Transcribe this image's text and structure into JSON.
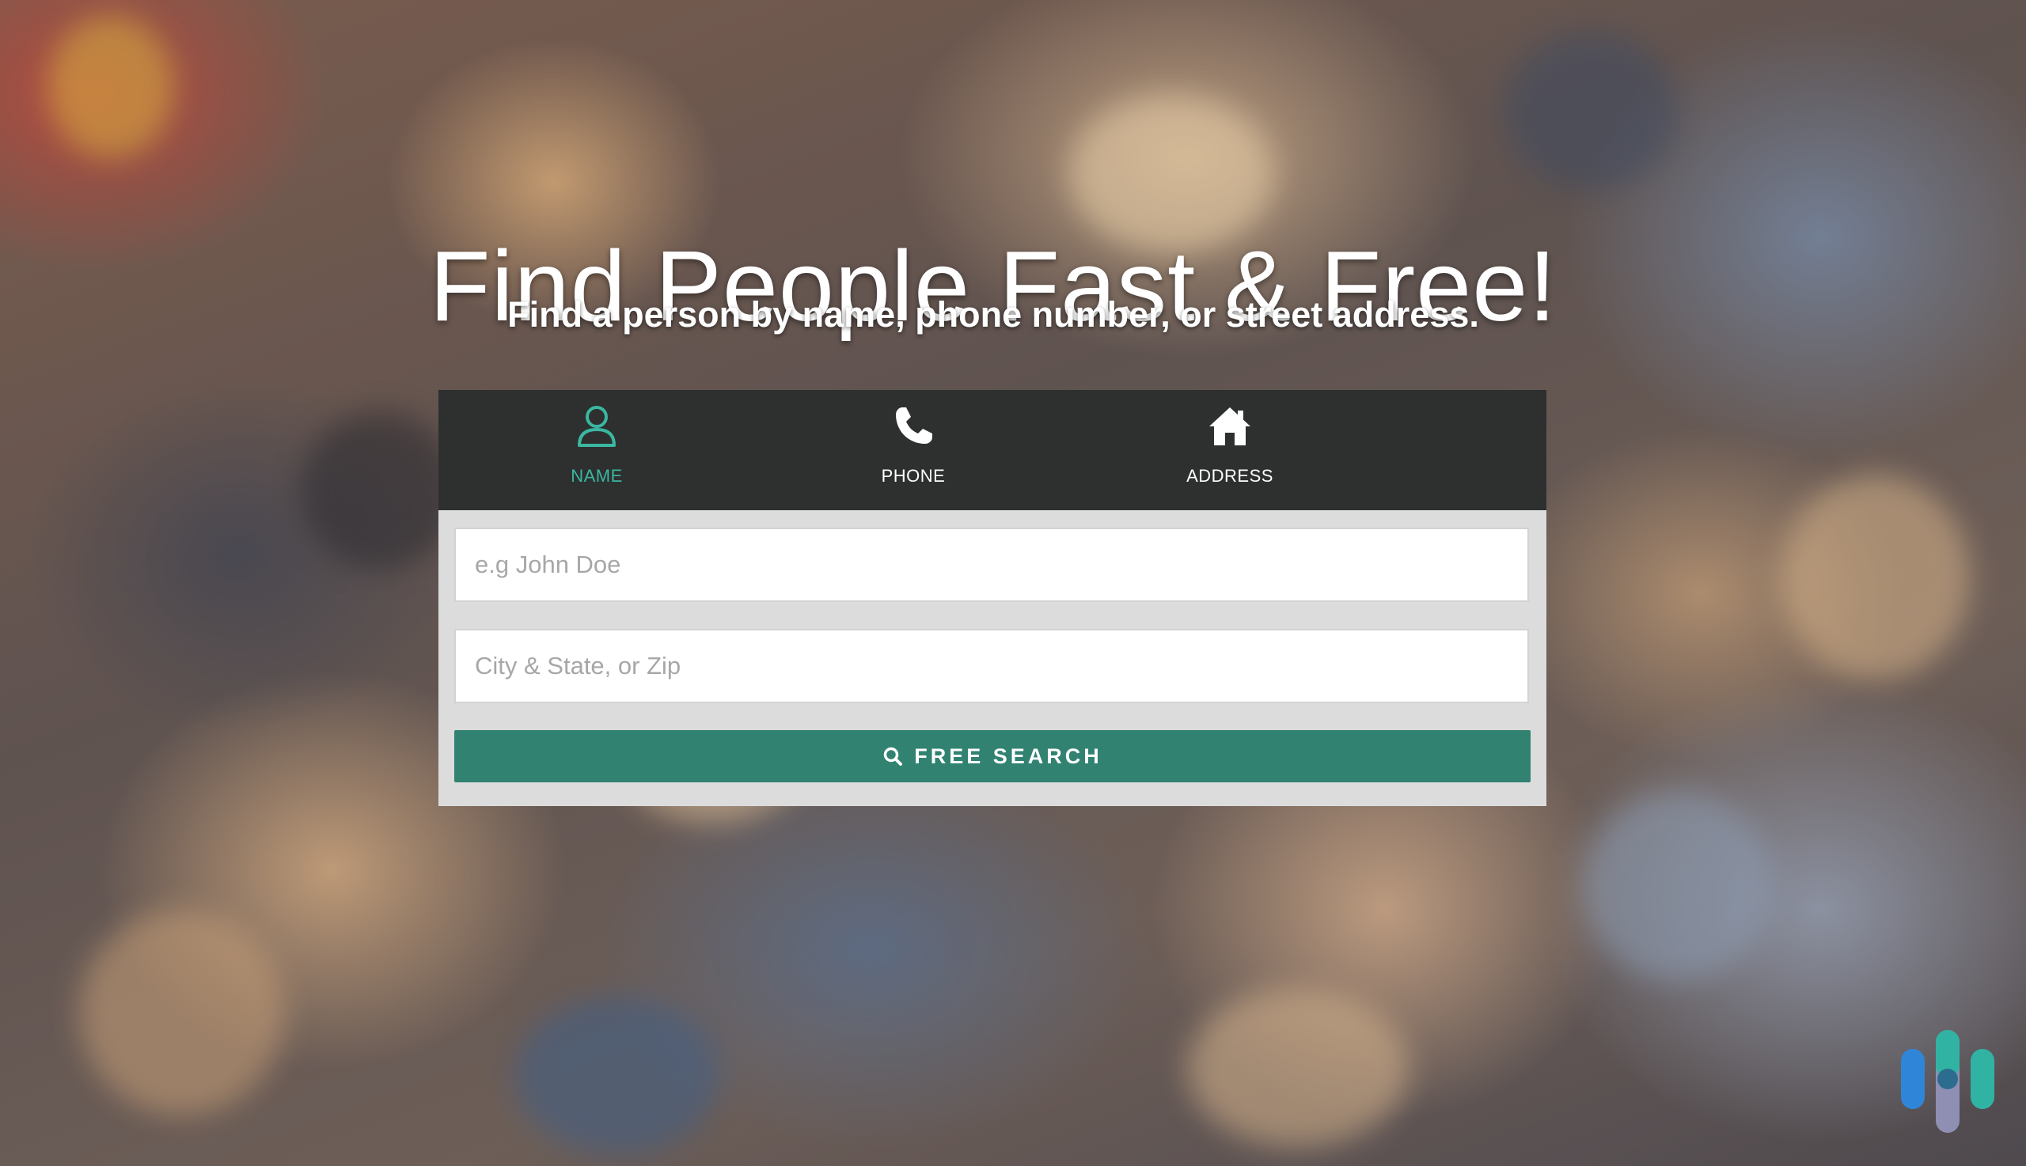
{
  "hero": {
    "title": "Find People Fast & Free!",
    "subtitle": "Find a person by name, phone number, or street address."
  },
  "tabs": [
    {
      "label": "NAME",
      "icon": "user-icon",
      "active": true
    },
    {
      "label": "PHONE",
      "icon": "phone-icon",
      "active": false
    },
    {
      "label": "ADDRESS",
      "icon": "home-icon",
      "active": false
    }
  ],
  "form": {
    "name_placeholder": "e.g John Doe",
    "name_value": "",
    "location_placeholder": "City & State, or Zip",
    "location_value": "",
    "search_label": "FREE SEARCH",
    "search_icon": "search-icon"
  },
  "colors": {
    "accent": "#3bb7a1",
    "button": "#318271",
    "tab_bar": "#2d302f",
    "form_bg": "#dcdcdc"
  },
  "logo": {
    "icon": "brand-logo-icon"
  }
}
